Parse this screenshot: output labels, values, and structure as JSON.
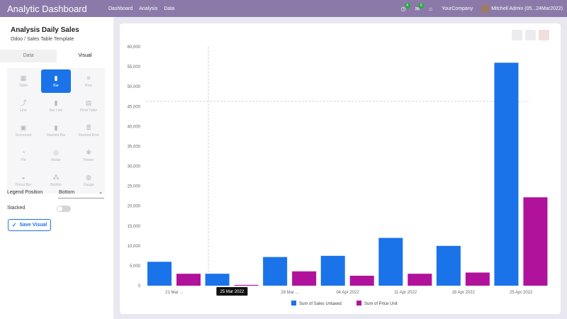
{
  "navbar": {
    "app_title": "Analytic Dashboard",
    "menu": [
      "Dashboard",
      "Analysis",
      "Data"
    ],
    "activity_count": "4",
    "messages_count": "5",
    "company": "YourCompany",
    "user": "Mitchell Admin (05...24Mar2022)"
  },
  "panel": {
    "title": "Analysis Daily Sales",
    "subtitle": "Odoo / Sales Table Template",
    "tabs": [
      "Data",
      "Visual"
    ],
    "chart_types": [
      {
        "label": "Table",
        "icon": "table-icon",
        "glyph": "▦",
        "active": false
      },
      {
        "label": "Bar",
        "icon": "bar-chart-icon",
        "glyph": "▮",
        "active": true
      },
      {
        "label": "Row",
        "icon": "row-chart-icon",
        "glyph": "≡",
        "active": false
      },
      {
        "label": "Line",
        "icon": "line-chart-icon",
        "glyph": "⤴",
        "active": false
      },
      {
        "label": "Bar Line",
        "icon": "bar-line-icon",
        "glyph": "▮",
        "active": false
      },
      {
        "label": "Pivot Table",
        "icon": "pivot-icon",
        "glyph": "▤",
        "active": false
      },
      {
        "label": "Scorecard",
        "icon": "scorecard-icon",
        "glyph": "▣",
        "active": false
      },
      {
        "label": "Stacked Bar",
        "icon": "stacked-bar-icon",
        "glyph": "▮",
        "active": false
      },
      {
        "label": "Stacked Row",
        "icon": "stacked-row-icon",
        "glyph": "≣",
        "active": false
      },
      {
        "label": "Pie",
        "icon": "pie-icon",
        "glyph": "◔",
        "active": false
      },
      {
        "label": "Radar",
        "icon": "radar-icon",
        "glyph": "◎",
        "active": false
      },
      {
        "label": "Flower",
        "icon": "flower-icon",
        "glyph": "✻",
        "active": false
      },
      {
        "label": "Donut Bar",
        "icon": "donut-bar-icon",
        "glyph": "◒",
        "active": false
      },
      {
        "label": "Bubble",
        "icon": "bubble-icon",
        "glyph": "⁂",
        "active": false
      },
      {
        "label": "Gauge",
        "icon": "gauge-icon",
        "glyph": "◍",
        "active": false
      }
    ],
    "legend_position_label": "Legend Position",
    "legend_position_value": "Bottom",
    "stacked_label": "Stacked",
    "stacked_on": false,
    "save_label": "Save Visual"
  },
  "chart_data": {
    "type": "bar",
    "categories": [
      "21 Mar ...",
      "25 Mar 2022",
      "28 Mar ...",
      "04 Apr 2022",
      "11 Apr 2022",
      "18 Apr 2022",
      "25 Apr 2022"
    ],
    "series": [
      {
        "name": "Sum of Sales Untaxed",
        "color": "#1a73e8",
        "values": [
          6000,
          3000,
          7200,
          7500,
          12000,
          10000,
          56000
        ]
      },
      {
        "name": "Sum of Price Unit",
        "color": "#b0129c",
        "values": [
          3000,
          200,
          3600,
          2500,
          3000,
          3300,
          22200
        ]
      }
    ],
    "ylim": [
      0,
      60000
    ],
    "yticks": [
      "0",
      "5,000",
      "10,000",
      "15,000",
      "20,000",
      "25,000",
      "30,000",
      "35,000",
      "40,000",
      "45,000",
      "50,000",
      "55,000",
      "60,000"
    ],
    "grid": false,
    "legend_position": "bottom",
    "tooltip": "25 Mar 2022"
  }
}
